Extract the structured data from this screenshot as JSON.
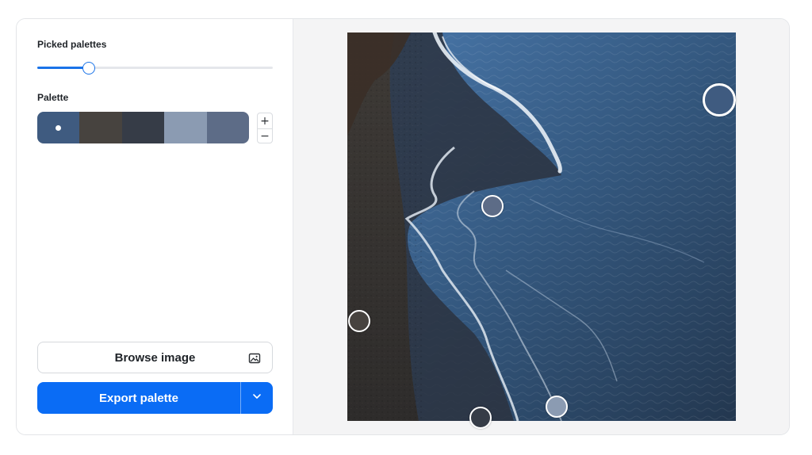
{
  "left_panel": {
    "picked_palettes_label": "Picked palettes",
    "picked_palettes_slider": {
      "value": 5,
      "min": 1,
      "max": 20,
      "fraction": 0.22
    },
    "palette_label": "Palette",
    "palette": [
      {
        "color": "#3f5b80",
        "selected": true
      },
      {
        "color": "#47433f",
        "selected": false
      },
      {
        "color": "#363c47",
        "selected": false
      },
      {
        "color": "#8b9bb2",
        "selected": false
      },
      {
        "color": "#5d6c87",
        "selected": false
      }
    ],
    "stepper": {
      "plus": "+",
      "minus": "−"
    },
    "browse_button": {
      "label": "Browse image",
      "icon": "image-icon"
    },
    "export_button": {
      "label": "Export palette",
      "dropdown_icon": "chevron-down-icon"
    }
  },
  "image_view": {
    "pickers": [
      {
        "name": "picker-1",
        "color": "#3f5b80",
        "size": "large"
      },
      {
        "name": "picker-2",
        "color": "#5d6c87",
        "size": "small"
      },
      {
        "name": "picker-3",
        "color": "#47433f",
        "size": "small"
      },
      {
        "name": "picker-4",
        "color": "#363c47",
        "size": "small"
      },
      {
        "name": "picker-5",
        "color": "#8b9bb2",
        "size": "small"
      }
    ]
  },
  "colors": {
    "accent": "#0a6cf5",
    "panel_bg": "#f4f4f5"
  }
}
